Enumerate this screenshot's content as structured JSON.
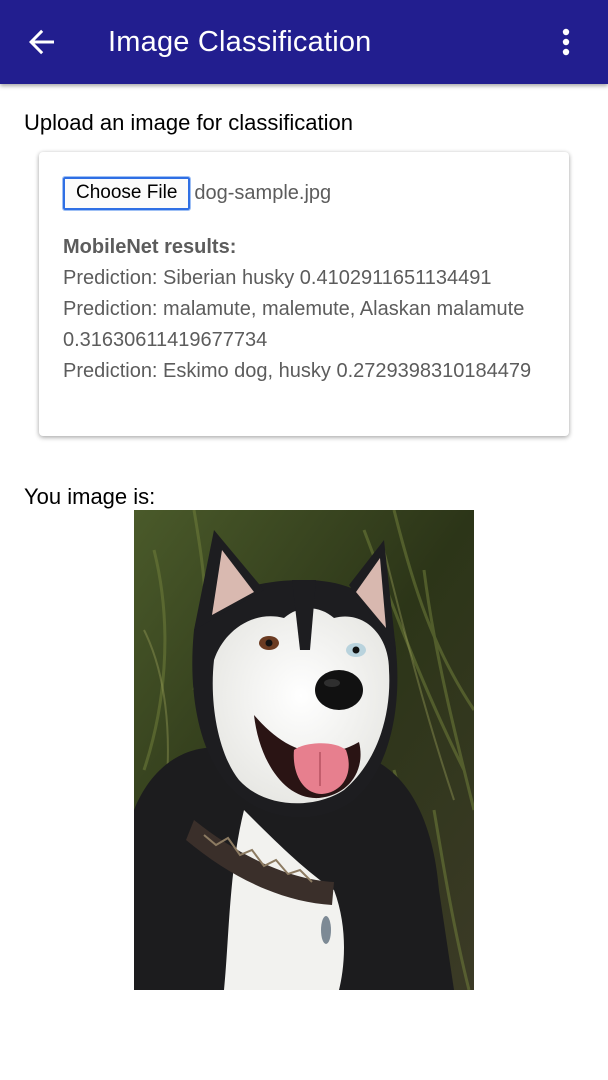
{
  "app_bar": {
    "title": "Image Classification",
    "back_icon": "arrow-back-icon",
    "menu_icon": "more-vert-icon",
    "color": "#221e8f"
  },
  "upload": {
    "heading": "Upload an image for classification",
    "button_label": "Choose File",
    "file_name": "dog-sample.jpg"
  },
  "results": {
    "title": "MobileNet results:",
    "predictions": [
      "Prediction: Siberian husky 0.4102911651134491",
      "Prediction: malamute, malemute, Alaskan malamute 0.31630611419677734",
      "Prediction: Eskimo dog, husky 0.2729398310184479"
    ]
  },
  "image_section": {
    "heading": "You image is:"
  }
}
